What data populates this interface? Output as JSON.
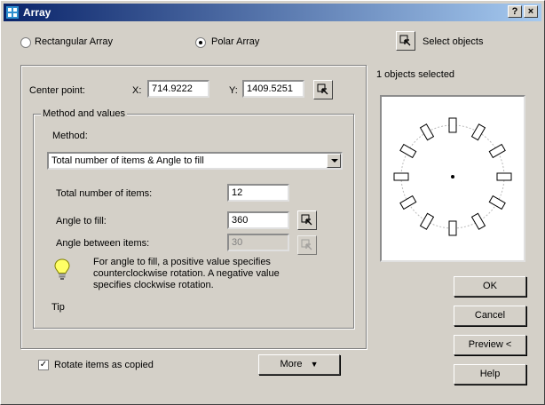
{
  "window": {
    "title": "Array",
    "help_label": "?",
    "close_label": "×"
  },
  "mode": {
    "rectangular_label": "Rectangular Array",
    "polar_label": "Polar Array",
    "selected": "polar"
  },
  "select_objects": {
    "label": "Select objects",
    "status": "1 objects selected"
  },
  "center_point": {
    "label": "Center point:",
    "x_label": "X:",
    "x_value": "714.9222",
    "y_label": "Y:",
    "y_value": "1409.5251"
  },
  "method_group": {
    "legend": "Method and values",
    "method_label": "Method:",
    "method_value": "Total number of items & Angle to fill",
    "total_items_label": "Total number of items:",
    "total_items_value": "12",
    "angle_fill_label": "Angle to fill:",
    "angle_fill_value": "360",
    "angle_between_label": "Angle between items:",
    "angle_between_value": "30"
  },
  "tip": {
    "label": "Tip",
    "text": "For angle to fill, a positive value specifies counterclockwise rotation.  A negative value specifies clockwise rotation."
  },
  "rotate_items": {
    "label": "Rotate items as copied",
    "checked": true
  },
  "more_button": {
    "label": "More",
    "arrow": "▼"
  },
  "buttons": {
    "ok": "OK",
    "cancel": "Cancel",
    "preview": "Preview <",
    "help": "Help"
  },
  "preview_pane": {
    "item_count": 12
  }
}
